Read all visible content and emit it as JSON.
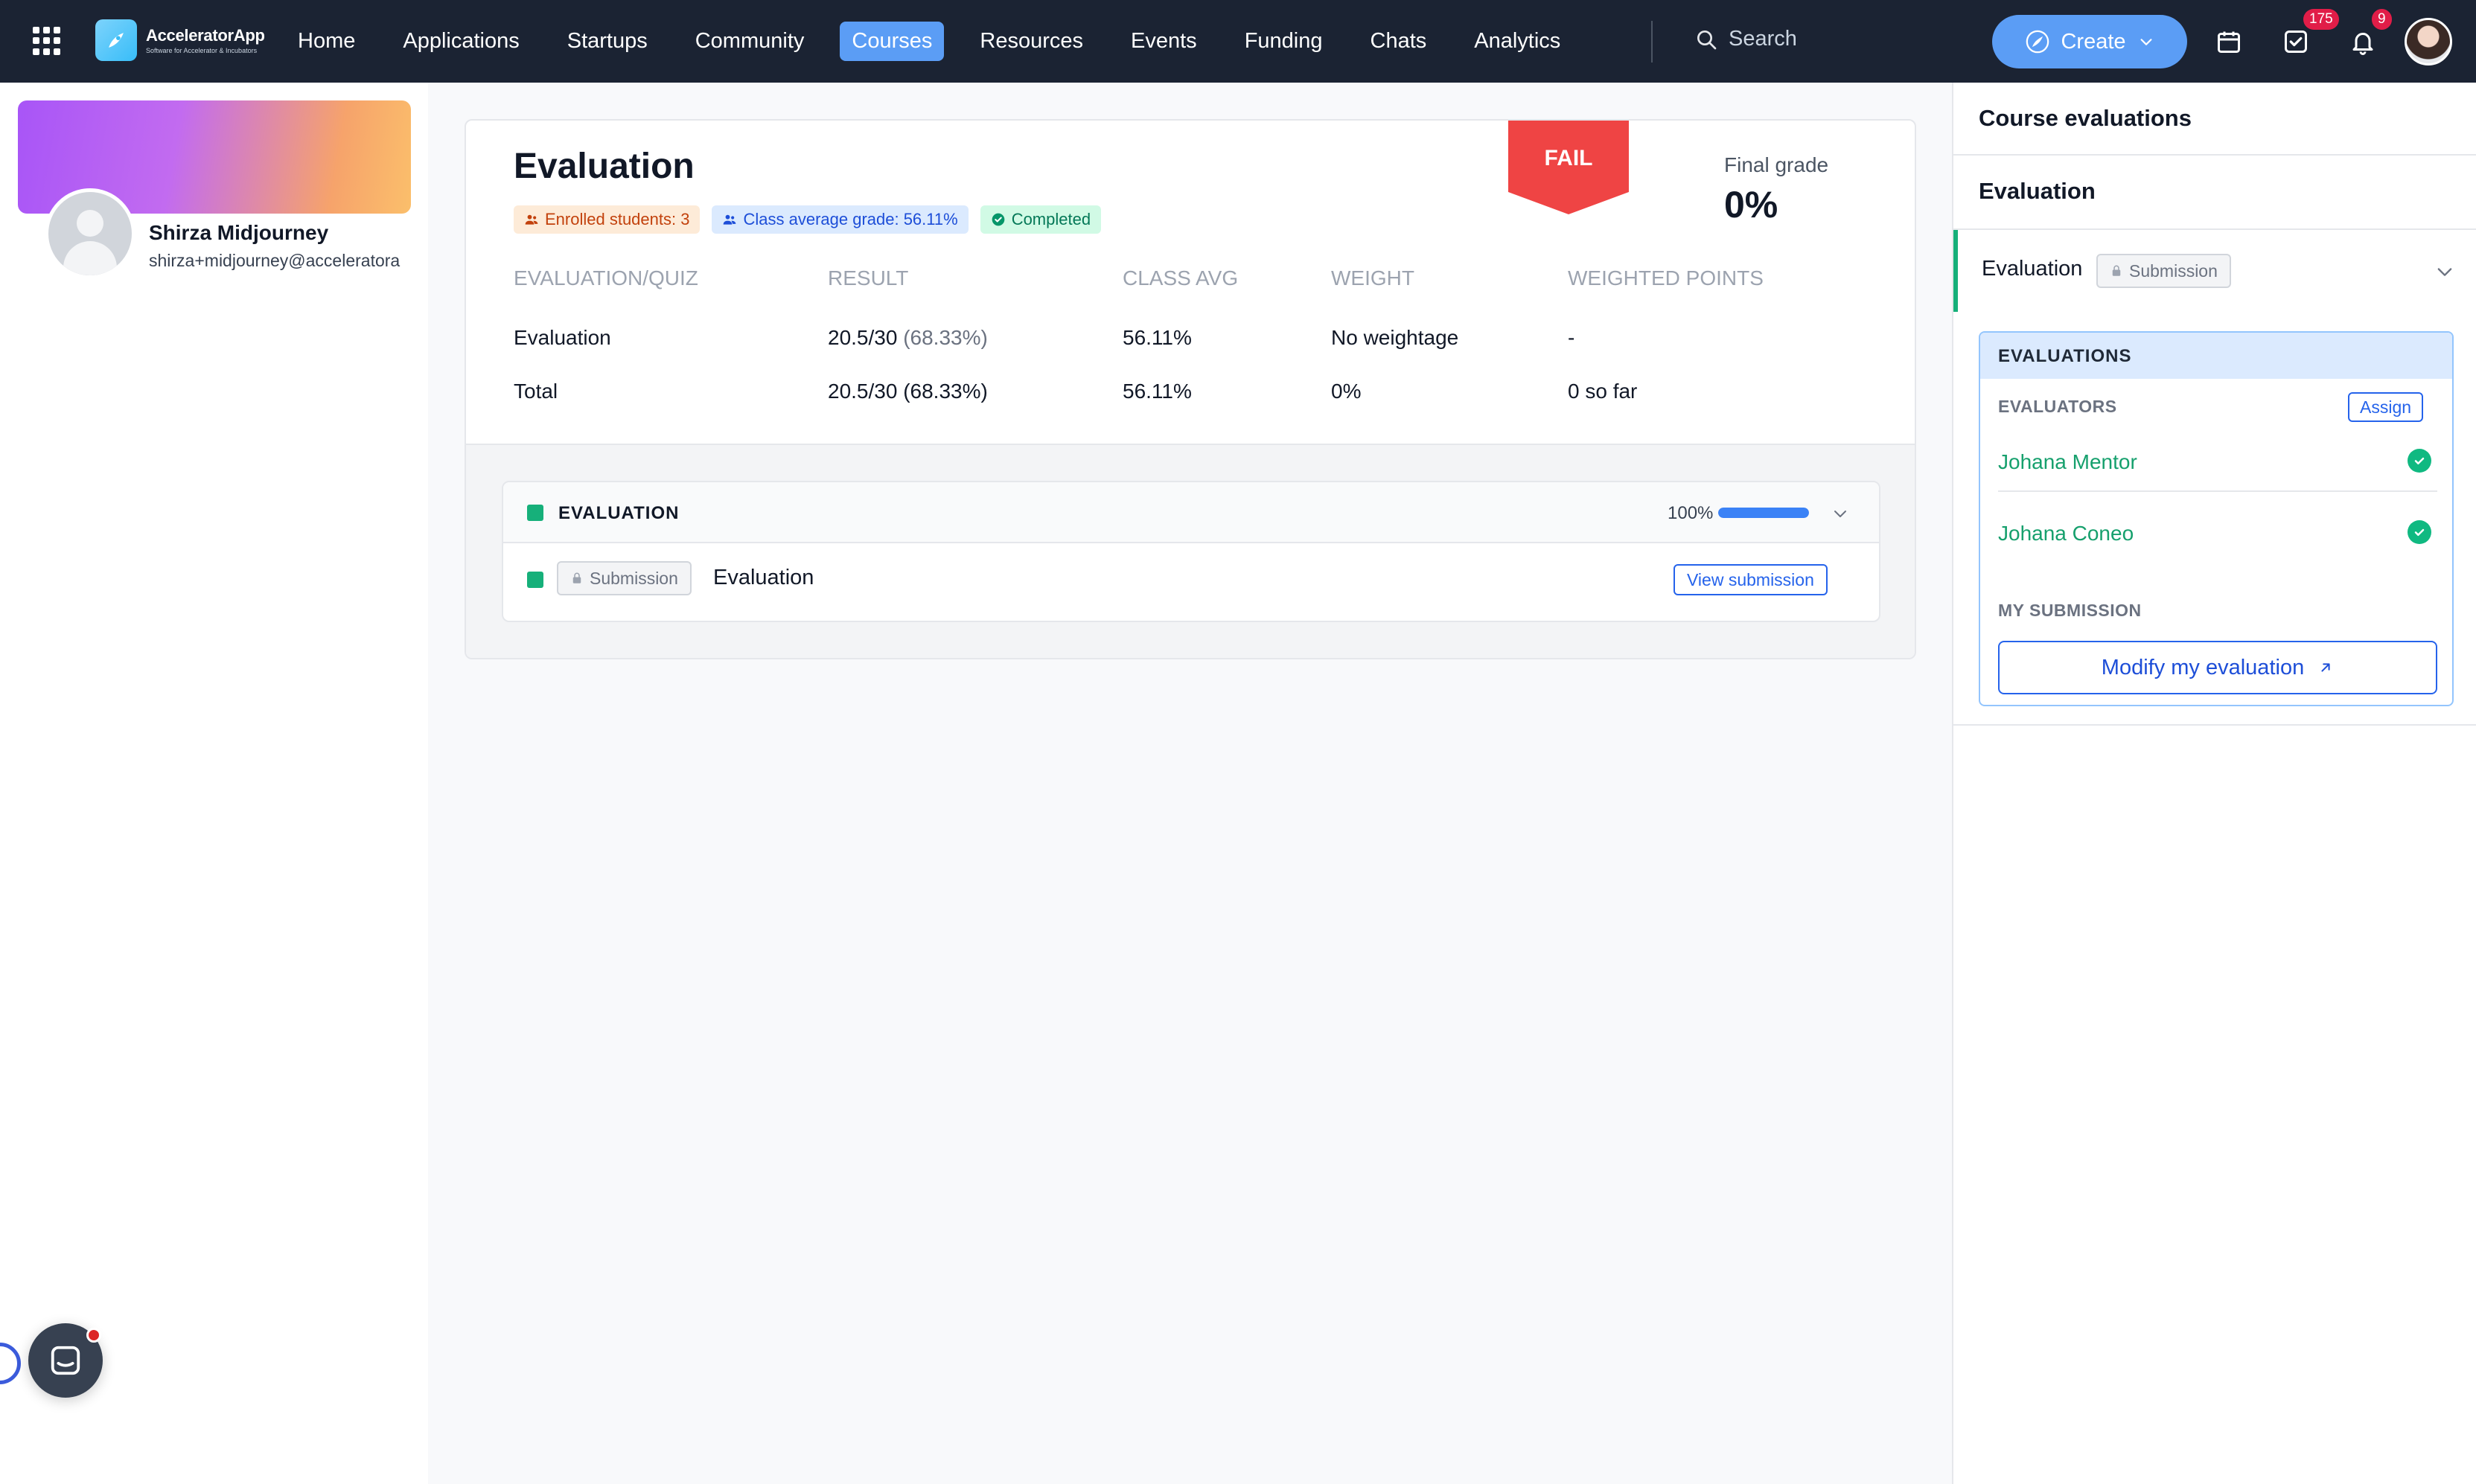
{
  "nav": {
    "brand_title": "AcceleratorApp",
    "brand_subtitle": "Software for Accelerator & Incubators",
    "items": [
      {
        "label": "Home",
        "active": false
      },
      {
        "label": "Applications",
        "active": false
      },
      {
        "label": "Startups",
        "active": false
      },
      {
        "label": "Community",
        "active": false
      },
      {
        "label": "Courses",
        "active": true
      },
      {
        "label": "Resources",
        "active": false
      },
      {
        "label": "Events",
        "active": false
      },
      {
        "label": "Funding",
        "active": false
      },
      {
        "label": "Chats",
        "active": false
      },
      {
        "label": "Analytics",
        "active": false
      }
    ],
    "search_placeholder": "Search",
    "create_label": "Create",
    "tasks_badge": "175",
    "notifications_badge": "9",
    "accent_color": "#5b9df5"
  },
  "profile": {
    "name": "Shirza Midjourney",
    "email": "shirza+midjourney@acceleratora"
  },
  "evaluation": {
    "title": "Evaluation",
    "tags": {
      "enrolled": "Enrolled students: 3",
      "class_avg": "Class average grade: 56.11%",
      "status": "Completed"
    },
    "fail_label": "FAIL",
    "final_grade_label": "Final grade",
    "final_grade_value": "0%",
    "table": {
      "headers": [
        "EVALUATION/QUIZ",
        "RESULT",
        "CLASS AVG",
        "WEIGHT",
        "WEIGHTED POINTS"
      ],
      "rows": [
        {
          "name": "Evaluation",
          "result": "20.5/30",
          "result_pct": "(68.33%)",
          "class_avg": "56.11%",
          "weight": "No weightage",
          "weighted_points": "-"
        },
        {
          "name": "Total",
          "result": "20.5/30 (68.33%)",
          "class_avg": "56.11%",
          "weight": "0%",
          "weighted_points": "0 so far"
        }
      ]
    },
    "section": {
      "label": "EVALUATION",
      "progress_text": "100%",
      "progress_value": 1.0,
      "item_type": "Submission",
      "item_name": "Evaluation",
      "view_button": "View submission"
    }
  },
  "right_panel": {
    "title": "Course evaluations",
    "subtitle": "Evaluation",
    "item_label": "Evaluation",
    "item_type": "Submission",
    "evaluations_header": "EVALUATIONS",
    "evaluators_label": "EVALUATORS",
    "assign_button": "Assign",
    "evaluators": [
      "Johana Mentor",
      "Johana Coneo"
    ],
    "my_submission_label": "MY SUBMISSION",
    "modify_button": "Modify my evaluation"
  }
}
